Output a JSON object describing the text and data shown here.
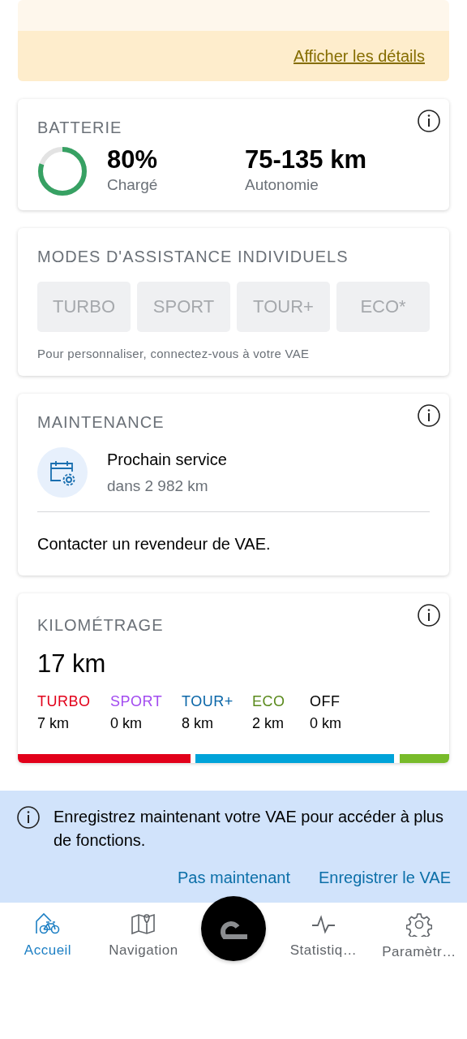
{
  "top_card": {
    "link": "Afficher les détails"
  },
  "battery": {
    "title": "BATTERIE",
    "charge": "80%",
    "charge_label": "Chargé",
    "range": "75-135 km",
    "range_label": "Autonomie"
  },
  "assist_modes": {
    "title": "MODES D'ASSISTANCE INDIVIDUELS",
    "modes": [
      {
        "label": "TURBO",
        "disabled": true
      },
      {
        "label": "SPORT",
        "disabled": true
      },
      {
        "label": "TOUR+",
        "disabled": true
      },
      {
        "label": "ECO*",
        "disabled": true
      }
    ],
    "hint": "Pour personnaliser, connectez-vous à votre VAE"
  },
  "maintenance": {
    "title": "MAINTENANCE",
    "service": "Prochain service",
    "service_distance": "dans 2 982 km",
    "dealer": "Contacter un revendeur de VAE."
  },
  "mileage": {
    "title": "KILOMÉTRAGE",
    "total": "17 km",
    "modes": [
      {
        "name": "TURBO",
        "distance": "7 km",
        "color": "#e2001a"
      },
      {
        "name": "SPORT",
        "distance": "0 km",
        "color": "#a24bf0"
      },
      {
        "name": "TOUR+",
        "distance": "8 km",
        "color": "#0a66a8"
      },
      {
        "name": "ECO",
        "distance": "2 km",
        "color": "#5a8a1c"
      },
      {
        "name": "OFF",
        "distance": "0 km",
        "color": "#000000"
      }
    ]
  },
  "banner": {
    "text": "Enregistrez maintenant votre VAE pour accéder à plus de fonctions.",
    "buttons": [
      "Pas maintenant",
      "Enregistrer le VAE"
    ]
  },
  "bottom_nav": [
    {
      "kind": "tab",
      "label": "Accueil",
      "selected": true
    },
    {
      "kind": "tab",
      "label": "Navigation",
      "selected": false
    },
    {
      "kind": "center"
    },
    {
      "kind": "tab",
      "label": "Statistiq…",
      "selected": false
    },
    {
      "kind": "tab",
      "label": "Paramètr…",
      "selected": false
    }
  ]
}
